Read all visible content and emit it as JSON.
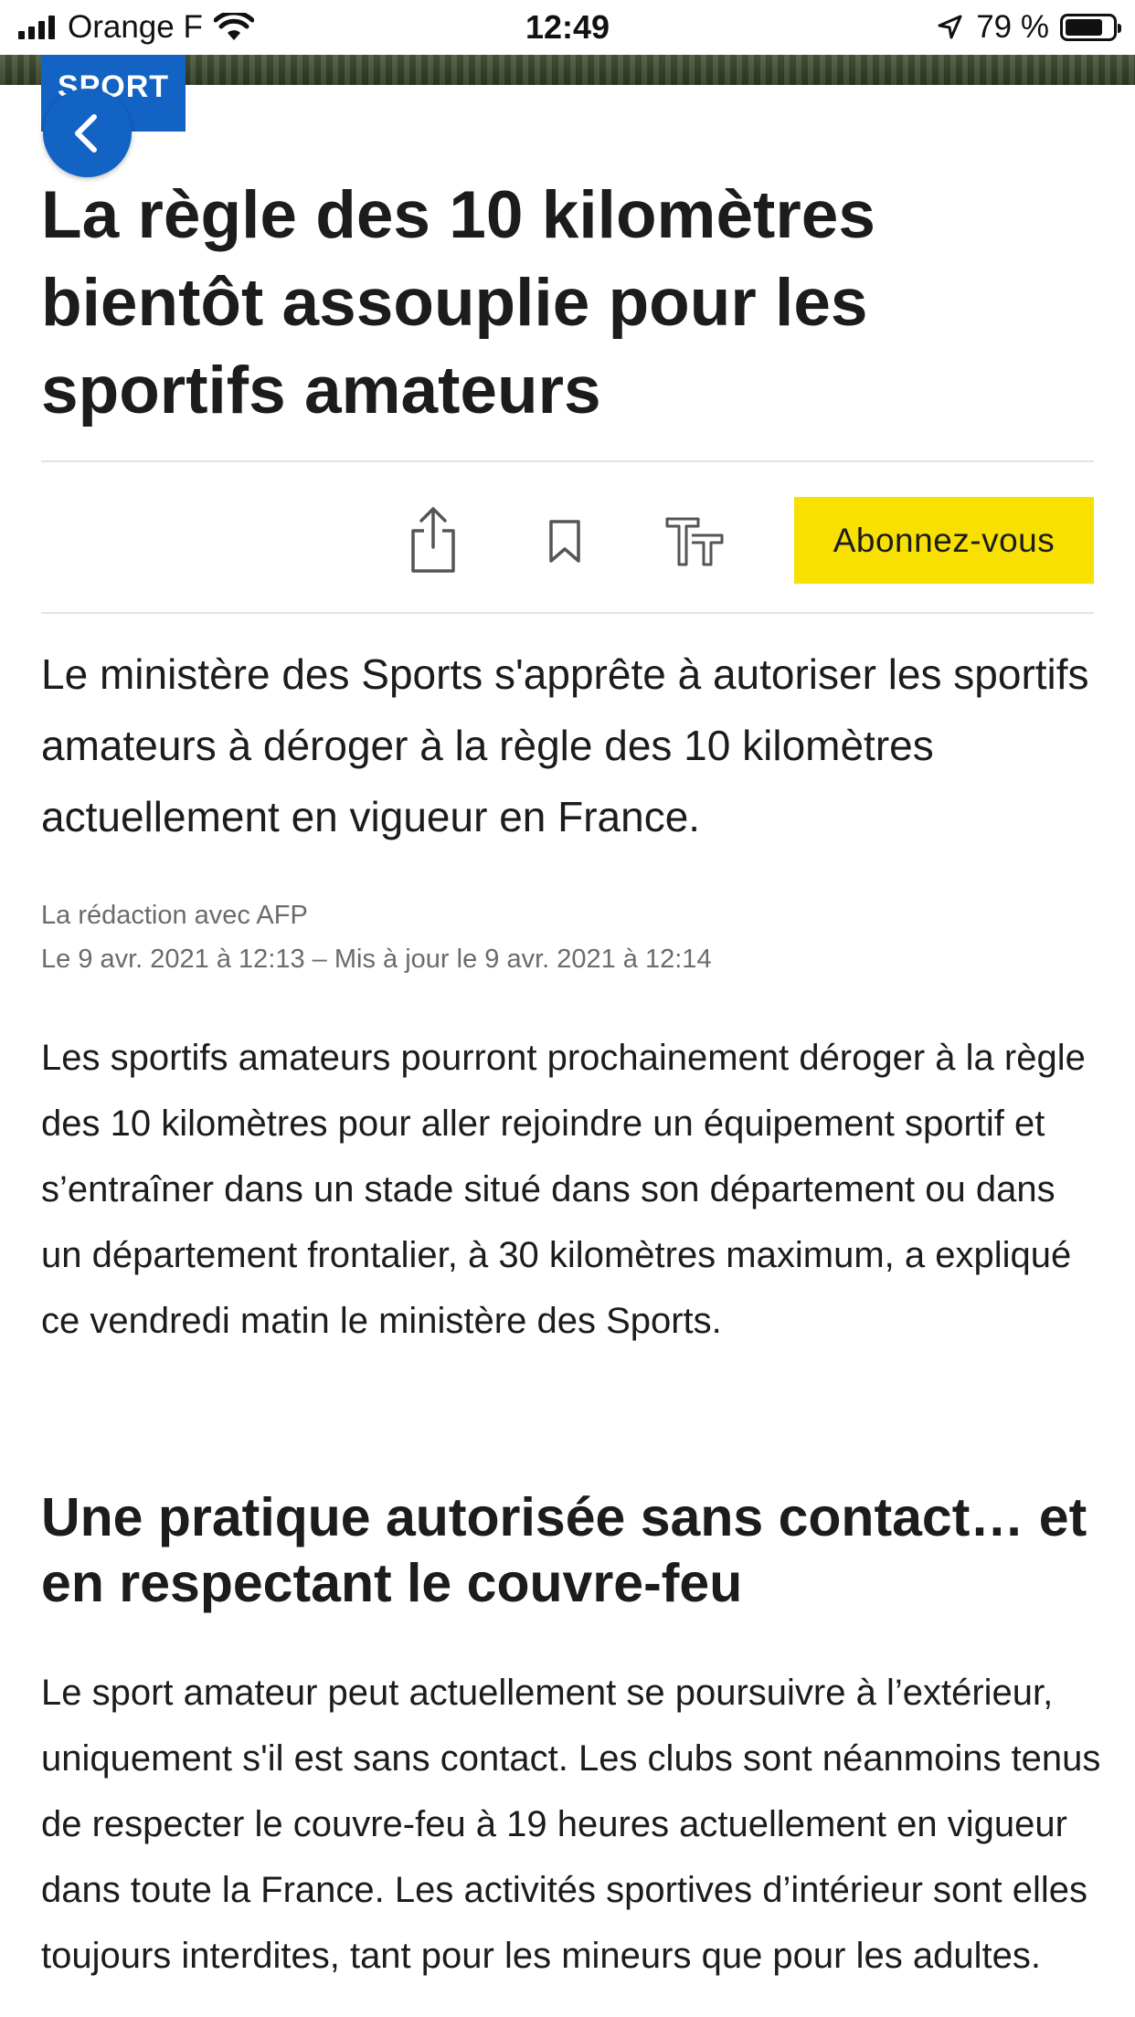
{
  "status_bar": {
    "carrier": "Orange F",
    "time": "12:49",
    "battery": "79 %",
    "battery_level": 0.79,
    "icons": [
      "signal-icon",
      "wifi-icon",
      "location-arrow-icon",
      "battery-icon"
    ]
  },
  "article": {
    "category": "SPORT",
    "title": "La règle des 10 kilomètres bientôt assouplie pour les sportifs amateurs",
    "lead": "Le ministère des Sports s'apprête à autoriser les sportifs amateurs à déroger à la règle des 10 kilomètres actuellement en vigueur en France.",
    "author": "La rédaction avec AFP",
    "dates": "Le 9 avr. 2021 à 12:13 – Mis à jour le 9 avr. 2021 à 12:14",
    "paragraph_1": "Les sportifs amateurs pourront prochainement déroger à la règle des 10 kilomètres pour aller rejoindre un équipement sportif et s’entraîner dans un stade situé dans son département ou dans un département frontalier, à 30 kilomètres maximum, a expliqué ce vendredi matin le ministère des Sports.",
    "subheading": "Une pratique autorisée sans contact… et en respectant le couvre-feu",
    "paragraph_2": "Le sport amateur peut actuellement se poursuivre à l’extérieur, uniquement s'il est sans contact. Les clubs sont néanmoins tenus de respecter le couvre-feu à 19 heures actuellement en vigueur dans toute la France. Les activités sportives d’intérieur sont elles toujours interdites, tant pour les mineurs que pour les adultes."
  },
  "toolbar": {
    "subscribe_label": "Abonnez-vous",
    "icons": [
      "share-icon",
      "bookmark-icon",
      "text-size-icon"
    ]
  },
  "colors": {
    "brand_blue": "#1263c4",
    "subscribe_yellow": "#f8e100",
    "text": "#1c1c1c",
    "meta_text": "#6b6b6b"
  }
}
